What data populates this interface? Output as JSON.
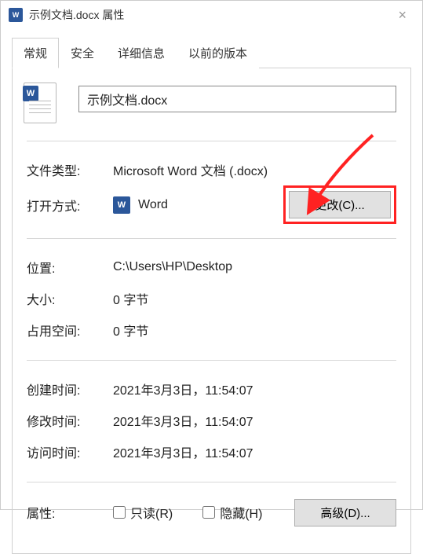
{
  "window": {
    "title": "示例文档.docx 属性"
  },
  "tabs": {
    "general": "常规",
    "security": "安全",
    "details": "详细信息",
    "previous": "以前的版本"
  },
  "filename": "示例文档.docx",
  "fields": {
    "type_label": "文件类型:",
    "type_value": "Microsoft Word 文档 (.docx)",
    "open_with_label": "打开方式:",
    "open_with_value": "Word",
    "change_btn": "更改(C)...",
    "location_label": "位置:",
    "location_value": "C:\\Users\\HP\\Desktop",
    "size_label": "大小:",
    "size_value": "0 字节",
    "disk_label": "占用空间:",
    "disk_value": "0 字节",
    "created_label": "创建时间:",
    "created_value": "2021年3月3日，11:54:07",
    "modified_label": "修改时间:",
    "modified_value": "2021年3月3日，11:54:07",
    "accessed_label": "访问时间:",
    "accessed_value": "2021年3月3日，11:54:07",
    "attr_label": "属性:",
    "readonly": "只读(R)",
    "hidden": "隐藏(H)",
    "advanced_btn": "高级(D)..."
  }
}
